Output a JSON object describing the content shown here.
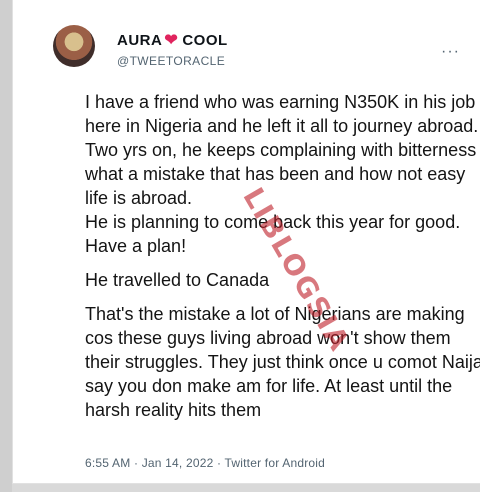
{
  "tweet": {
    "display_name_left": "AURA",
    "display_name_right": "COOL",
    "heart_emoji": "❤",
    "handle": "@TWEETORACLE",
    "more": "···",
    "paragraphs": [
      "I have a friend who was earning N350K in his job here in Nigeria and he left it all to journey abroad.",
      "Two yrs on, he keeps complaining with bitterness what a mistake that has been and how not easy life is abroad.",
      "He is planning to come back this year for good.",
      "Have a plan!",
      "He travelled to Canada",
      "That's the mistake a lot of Nigerians are making cos these guys living abroad won't show them their struggles. They just think once u comot Naija say you don make am for life. At least until the harsh reality hits them"
    ],
    "timestamp": "6:55 AM · Jan 14, 2022 · Twitter for Android"
  },
  "watermark": "LIBLOGSIA"
}
